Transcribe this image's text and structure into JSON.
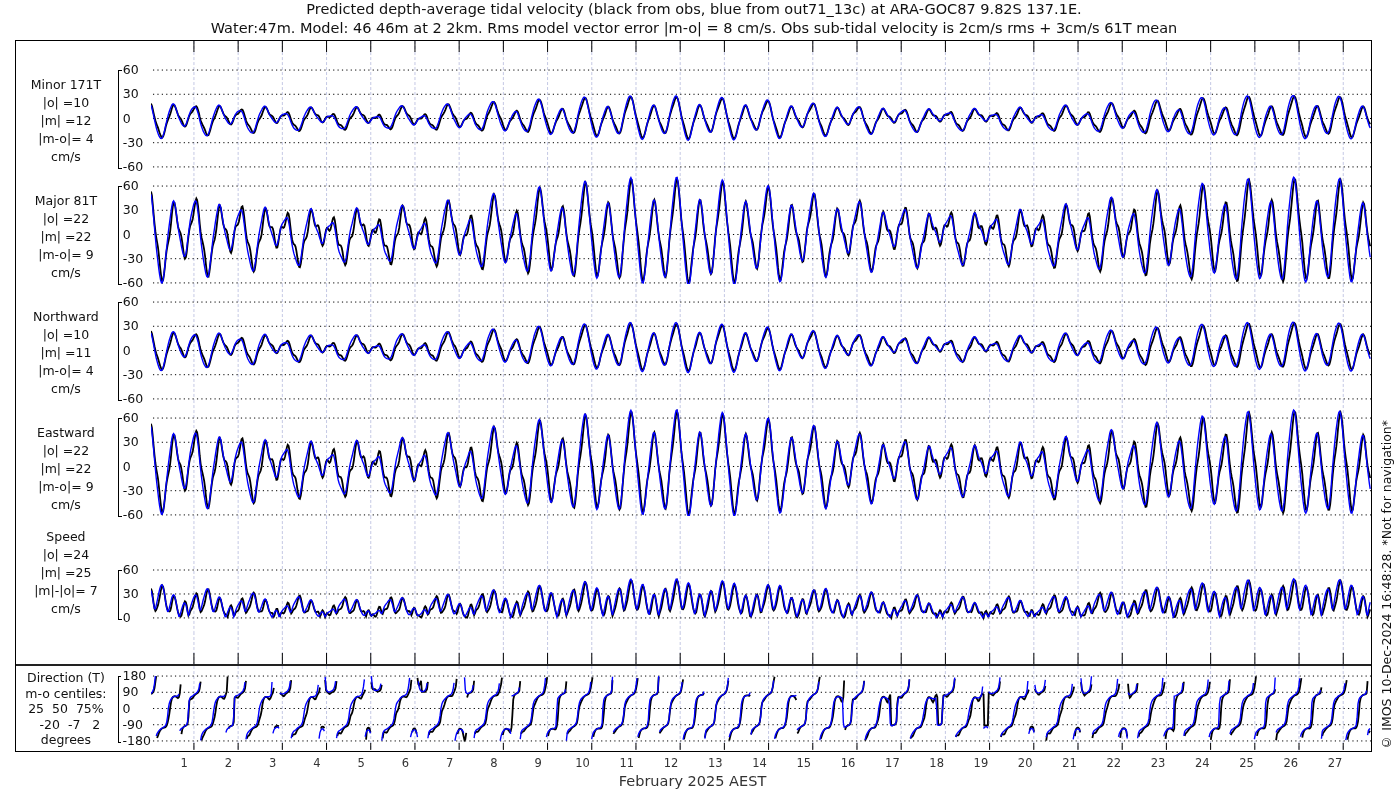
{
  "title_lines": [
    "Predicted depth-average tidal velocity (black from obs, blue from out71_13c) at ARA-GOC87 9.82S 137.1E.",
    "Water:47m. Model: 46 46m at 2 2km. Rms model vector error |m-o| = 8 cm/s. Obs sub-tidal velocity is 2cm/s rms + 3cm/s 61T mean"
  ],
  "traces": [
    {
      "color": "#000000"
    },
    {
      "color": "#0000ff"
    }
  ],
  "panels": [
    {
      "kind": "minor",
      "label_lines": [
        "Minor 171T",
        "|o| =10",
        "|m| =12",
        "|m-o|= 4",
        "cm/s"
      ],
      "yticks": [
        "60",
        "30",
        "0",
        "-30",
        "-60"
      ]
    },
    {
      "kind": "major",
      "label_lines": [
        "Major 81T",
        "|o| =22",
        "|m| =22",
        "|m-o|= 9",
        "cm/s"
      ],
      "yticks": [
        "60",
        "30",
        "0",
        "-30",
        "-60"
      ]
    },
    {
      "kind": "northward",
      "label_lines": [
        "Northward",
        "|o| =10",
        "|m| =11",
        "|m-o|= 4",
        "cm/s"
      ],
      "yticks": [
        "60",
        "30",
        "0",
        "-30",
        "-60"
      ]
    },
    {
      "kind": "eastward",
      "label_lines": [
        "Eastward",
        "|o| =22",
        "|m| =22",
        "|m-o|= 9",
        "cm/s"
      ],
      "yticks": [
        "60",
        "30",
        "0",
        "-30",
        "-60"
      ]
    },
    {
      "kind": "speed",
      "label_lines": [
        "Speed",
        "|o| =24",
        "|m| =25",
        "|m|-|o|= 7",
        "cm/s"
      ],
      "yticks": [
        "60",
        "30",
        "0"
      ]
    },
    {
      "kind": "direction",
      "label_lines": [
        "Direction (T)",
        "m-o centiles:",
        "25  50  75%",
        "  -20  -7   2",
        "degrees"
      ],
      "yticks": [
        "180",
        "90",
        "0",
        "-90",
        "-180"
      ]
    }
  ],
  "x_axis": {
    "day_labels": [
      "1",
      "2",
      "3",
      "4",
      "5",
      "6",
      "7",
      "8",
      "9",
      "10",
      "11",
      "12",
      "13",
      "14",
      "15",
      "16",
      "17",
      "18",
      "19",
      "20",
      "21",
      "22",
      "23",
      "24",
      "25",
      "26",
      "27"
    ],
    "label": "February 2025 AEST"
  },
  "footer": "© IMOS 10-Dec-2024 16:48:28. *Not for navigation*"
}
